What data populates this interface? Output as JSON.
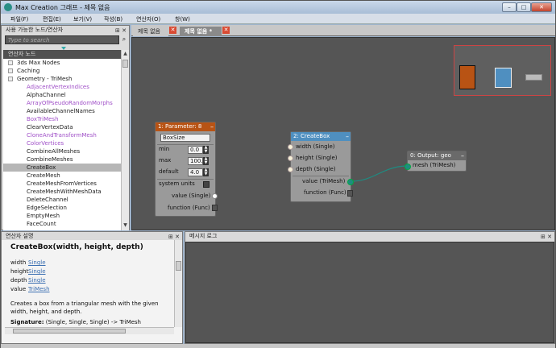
{
  "window": {
    "title": "Max Creation 그래프 - 제목 없음",
    "min": "–",
    "max": "□",
    "close": "✕"
  },
  "menu": [
    "파일(F)",
    "편집(E)",
    "보기(V)",
    "작성(B)",
    "연산자(O)",
    "창(W)"
  ],
  "nodes_panel": {
    "title": "사용 가능한 노드/연산자",
    "search_placeholder": "Type to search",
    "tree_header": "연산자 노드",
    "categories": [
      "3ds Max Nodes",
      "Caching",
      "Geometry - TriMesh"
    ],
    "items": [
      {
        "label": "AdjacentVertexIndices",
        "purple": true
      },
      {
        "label": "AlphaChannel",
        "purple": false
      },
      {
        "label": "ArrayOfPseudoRandomMorphs",
        "purple": true
      },
      {
        "label": "AvailableChannelNames",
        "purple": false
      },
      {
        "label": "BoxTriMesh",
        "purple": true
      },
      {
        "label": "ClearVertexData",
        "purple": false
      },
      {
        "label": "CloneAndTransformMesh",
        "purple": true
      },
      {
        "label": "ColorVertices",
        "purple": true
      },
      {
        "label": "CombineAllMeshes",
        "purple": false
      },
      {
        "label": "CombineMeshes",
        "purple": false
      },
      {
        "label": "CreateBox",
        "purple": false,
        "selected": true
      },
      {
        "label": "CreateMesh",
        "purple": false
      },
      {
        "label": "CreateMeshFromVertices",
        "purple": false
      },
      {
        "label": "CreateMeshWithMeshData",
        "purple": false
      },
      {
        "label": "DeleteChannel",
        "purple": false
      },
      {
        "label": "EdgeSelection",
        "purple": false
      },
      {
        "label": "EmptyMesh",
        "purple": false
      },
      {
        "label": "FaceCount",
        "purple": false
      }
    ]
  },
  "tabs": [
    {
      "label": "제목 없음",
      "close": "✕"
    },
    {
      "label": "제목 없음 *",
      "close": "✕"
    }
  ],
  "graph": {
    "param_node": {
      "title": "1: Parameter: 8",
      "name": "BoxSize",
      "min_label": "min",
      "min_value": "0.0",
      "max_label": "max",
      "max_value": "100.0",
      "default_label": "default",
      "default_value": "4.0",
      "system_units": "system units",
      "output_value": "value (Single)",
      "output_func": "function (Func)"
    },
    "createbox_node": {
      "title": "2: CreateBox",
      "inputs": [
        "width (Single)",
        "height (Single)",
        "depth (Single)"
      ],
      "output_value": "value (TriMesh)",
      "output_func": "function (Func)"
    },
    "output_node": {
      "title": "0: Output: geo",
      "input": "mesh (TriMesh)"
    },
    "colors": {
      "param_title": "#b85314",
      "createbox_title": "#4f8fc0",
      "output_title": "#6a6a6a",
      "teal": "#1e8c82"
    }
  },
  "description": {
    "title": "연산자 설명",
    "signature_title": "CreateBox(width, height, depth)",
    "params": [
      {
        "name": "width",
        "type": "Single"
      },
      {
        "name": "height",
        "type": "Single"
      },
      {
        "name": "depth",
        "type": "Single"
      },
      {
        "name": "value",
        "type": "TriMesh"
      }
    ],
    "text": "Creates a box from a triangular mesh with the given width, height, and depth.",
    "signature_label": "Signature:",
    "signature": "(Single, Single, Single) -> TriMesh"
  },
  "log": {
    "title": "메시지 로그"
  },
  "pane_icons": "⊞ ✕"
}
